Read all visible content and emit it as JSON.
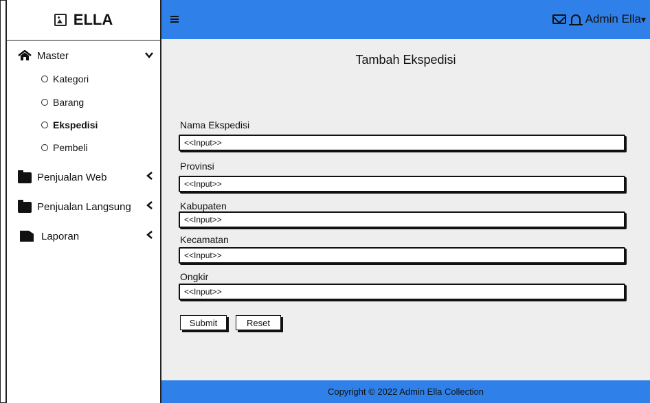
{
  "brand": {
    "name": "ELLA",
    "icon": "image-icon"
  },
  "header": {
    "menu_icon": "hamburger-icon",
    "mail_icon": "mail-icon",
    "bell_icon": "bell-icon",
    "user_label": "Admin Ella",
    "caret": "▾"
  },
  "sidebar": {
    "master": {
      "label": "Master",
      "icon": "home-icon",
      "chevron": "⌄",
      "items": [
        {
          "label": "Kategori"
        },
        {
          "label": "Barang"
        },
        {
          "label": "Ekspedisi",
          "active": true
        },
        {
          "label": "Pembeli"
        }
      ]
    },
    "penjualan_web": {
      "label": "Penjualan Web",
      "icon": "folder-icon",
      "chevron": "‹"
    },
    "penjualan_langsung": {
      "label": "Penjualan Langsung",
      "icon": "folder-icon",
      "chevron": "‹"
    },
    "laporan": {
      "label": "Laporan",
      "icon": "file-icon",
      "chevron": "‹"
    }
  },
  "main": {
    "title": "Tambah Ekspedisi",
    "fields": [
      {
        "label": "Nama Ekspedisi",
        "value": "<<Input>>"
      },
      {
        "label": "Provinsi",
        "value": "<<Input>>"
      },
      {
        "label": "Kabupaten",
        "value": "<<Input>>"
      },
      {
        "label": "Kecamatan",
        "value": "<<Input>>"
      },
      {
        "label": "Ongkir",
        "value": "<<Input>>"
      }
    ],
    "submit_label": "Submit",
    "reset_label": "Reset"
  },
  "footer": {
    "text": "Copyright © 2022 Admin Ella Collection"
  },
  "colors": {
    "accent": "#2f80e8",
    "content_bg": "#eeeeee"
  }
}
